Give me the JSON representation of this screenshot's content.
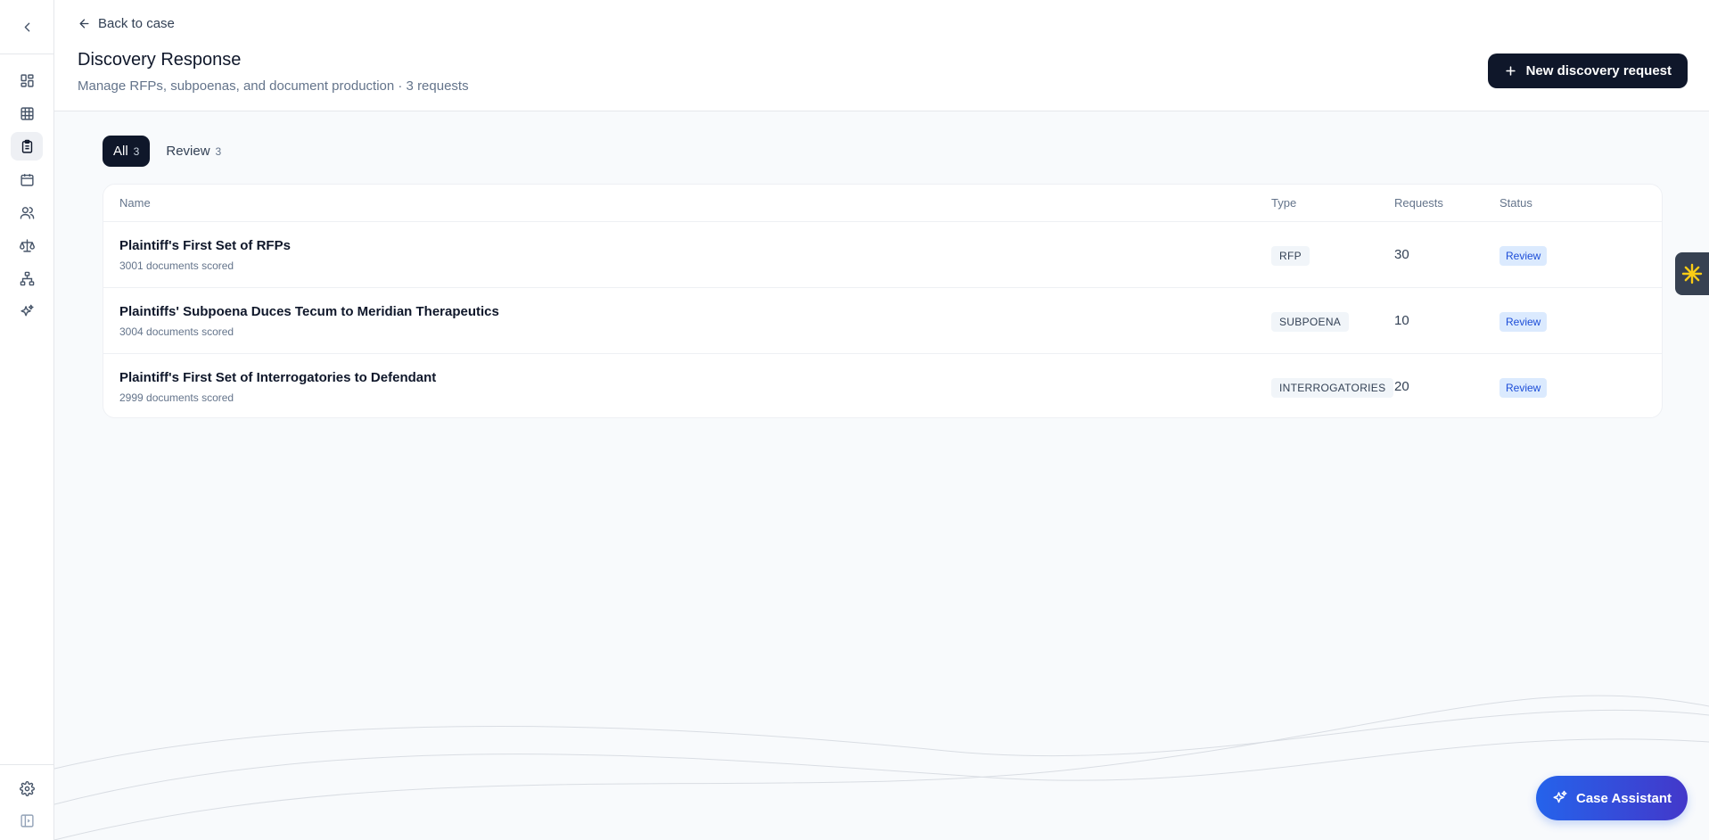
{
  "header": {
    "back_label": "Back to case",
    "title": "Discovery Response",
    "subtitle": "Manage RFPs, subpoenas, and document production · 3 requests",
    "new_button_label": "New discovery request"
  },
  "tabs": [
    {
      "label": "All",
      "count": "3"
    },
    {
      "label": "Review",
      "count": "3"
    }
  ],
  "table": {
    "columns": {
      "name": "Name",
      "type": "Type",
      "requests": "Requests",
      "status": "Status"
    },
    "rows": [
      {
        "name": "Plaintiff's First Set of RFPs",
        "meta": "3001 documents scored",
        "type": "RFP",
        "requests": "30",
        "status": "Review"
      },
      {
        "name": "Plaintiffs' Subpoena Duces Tecum to Meridian Therapeutics",
        "meta": "3004 documents scored",
        "type": "SUBPOENA",
        "requests": "10",
        "status": "Review"
      },
      {
        "name": "Plaintiff's First Set of Interrogatories to Defendant",
        "meta": "2999 documents scored",
        "type": "INTERROGATORIES",
        "requests": "20",
        "status": "Review"
      }
    ]
  },
  "assistant_label": "Case Assistant",
  "sidebar": {
    "icons": [
      "chevron-left-icon",
      "dashboard-icon",
      "table-icon",
      "clipboard-icon",
      "calendar-icon",
      "users-icon",
      "scale-icon",
      "hierarchy-icon",
      "sparkles-icon",
      "gear-icon",
      "panel-toggle-icon"
    ]
  },
  "colors": {
    "primary": "#0f172a",
    "accent": "#2563eb",
    "status_bg": "#dbeafe",
    "status_text": "#1d4ed8"
  }
}
